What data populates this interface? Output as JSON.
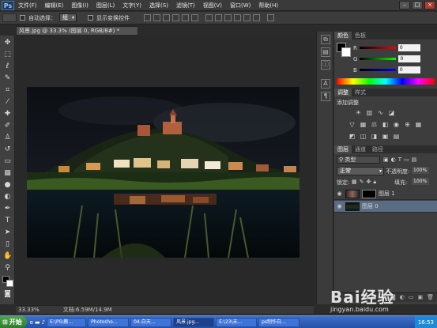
{
  "app": {
    "logo": "Ps"
  },
  "menu": [
    "文件(F)",
    "编辑(E)",
    "图像(I)",
    "图层(L)",
    "文字(Y)",
    "选择(S)",
    "滤镜(T)",
    "视图(V)",
    "窗口(W)",
    "帮助(H)"
  ],
  "window_buttons": {
    "minimize": "–",
    "maximize": "□",
    "close": "×"
  },
  "options_bar": {
    "auto_select_label": "自动选择：",
    "auto_select_value": "组",
    "show_transform_label": "显示变换控件"
  },
  "document": {
    "tab_title": "风景.jpg @ 33.3% (图层 0, RGB/8#) *",
    "zoom": "33.33%",
    "doc_info": "文档:6.59M/14.9M"
  },
  "color_panel": {
    "tabs": [
      "颜色",
      "色板"
    ],
    "rows": [
      {
        "channel": "R",
        "value": "0"
      },
      {
        "channel": "G",
        "value": "0"
      },
      {
        "channel": "B",
        "value": "0"
      }
    ]
  },
  "adjustments_panel": {
    "tabs": [
      "调整",
      "样式"
    ],
    "heading": "添加调整"
  },
  "layers_panel": {
    "tabs": [
      "图层",
      "通道",
      "路径"
    ],
    "kind_label": "类型",
    "blend_mode": "正常",
    "opacity_label": "不透明度:",
    "opacity_value": "100%",
    "lock_label": "锁定:",
    "fill_label": "填充:",
    "fill_value": "100%",
    "layers": [
      {
        "name": "图层 1"
      },
      {
        "name": "图层 0"
      }
    ]
  },
  "taskbar": {
    "start": "开始",
    "items": [
      "E:\\PS\\教...",
      "Photosho...",
      "04-白天...",
      "风景.jpg...",
      "E:\\23\\未...",
      "ps制作白..."
    ],
    "clock": "16:53"
  },
  "watermark": {
    "brand": "Bai经验",
    "url": "jingyan.baidu.com"
  },
  "colors": {
    "accent": "#2451a8",
    "panel_bg": "#3d3d3d",
    "canvas_bg": "#292929"
  }
}
